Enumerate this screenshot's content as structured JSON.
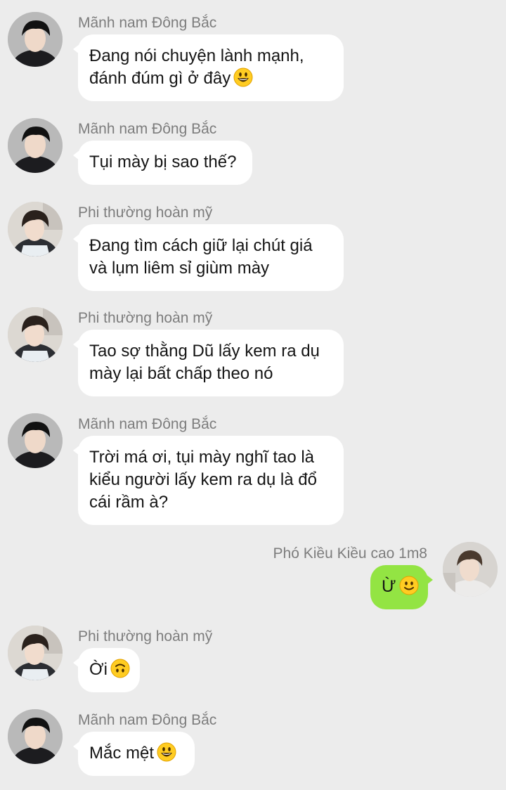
{
  "chat": {
    "messages": [
      {
        "sender": "Mãnh nam Đông Bắc",
        "lines": [
          "Đang nói chuyện lành mạnh,",
          "đánh đúm gì ở đây"
        ],
        "emoji": "grinning-face"
      },
      {
        "sender": "Mãnh nam Đông Bắc",
        "lines": [
          "Tụi mày bị sao thế?"
        ]
      },
      {
        "sender": "Phi thường hoàn mỹ",
        "lines": [
          "Đang tìm cách giữ lại chút giá",
          "và lụm liêm sỉ giùm mày"
        ]
      },
      {
        "sender": "Phi thường hoàn mỹ",
        "lines": [
          "Tao sợ thằng Dũ lấy kem ra dụ",
          "mày lại bất chấp theo nó"
        ]
      },
      {
        "sender": "Mãnh nam Đông Bắc",
        "lines": [
          "Trời má ơi, tụi mày nghĩ tao là",
          "kiểu người lấy kem ra dụ là đổ",
          "cái rầm à?"
        ]
      },
      {
        "sender": "Phó Kiều Kiều cao 1m8",
        "lines": [
          "Ừ"
        ],
        "emoji": "slightly-smiling-face",
        "outgoing": true
      },
      {
        "sender": "Phi thường hoàn mỹ",
        "lines": [
          "Ời"
        ],
        "emoji": "upside-down-face"
      },
      {
        "sender": "Mãnh nam Đông Bắc",
        "lines": [
          "Mắc mệt"
        ],
        "emoji": "grinning-face"
      }
    ]
  },
  "colors": {
    "background": "#ececec",
    "incoming_bubble": "#ffffff",
    "outgoing_bubble": "#93e443",
    "sender_name": "#7d7d7d"
  }
}
